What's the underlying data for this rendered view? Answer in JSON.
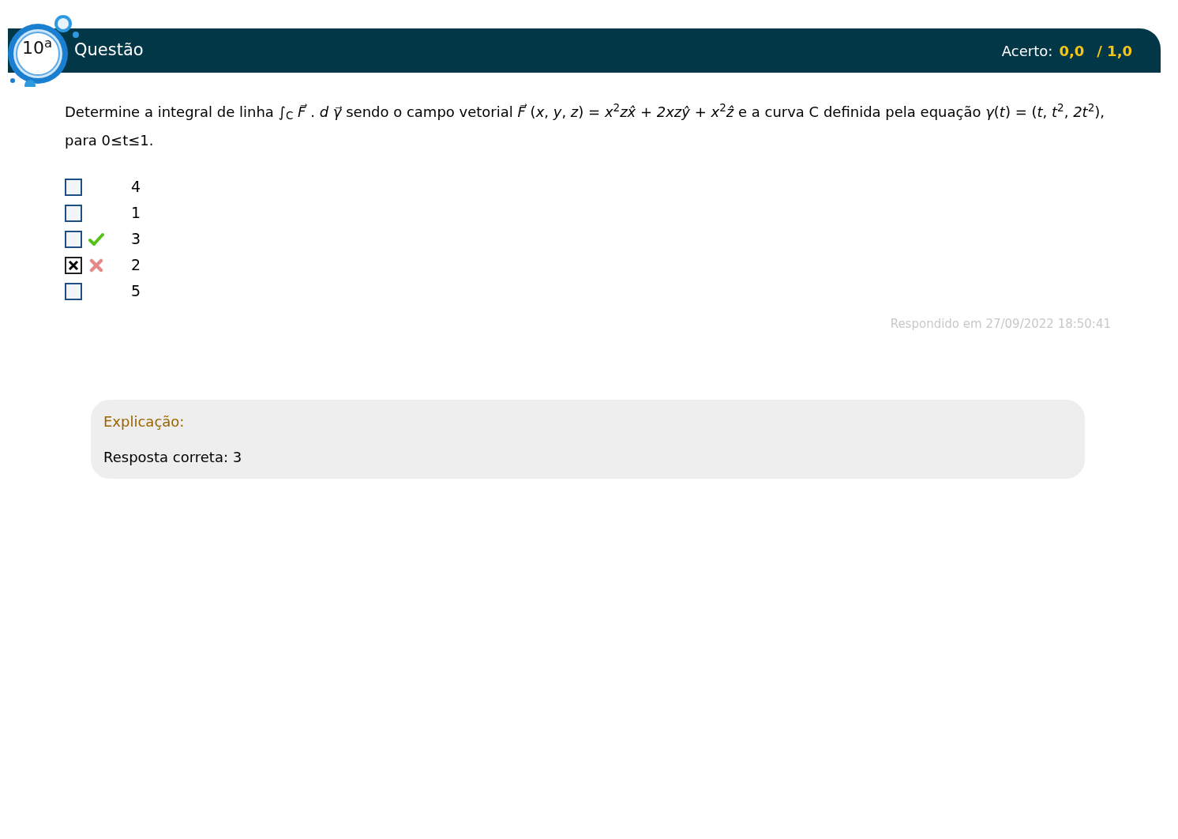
{
  "header": {
    "number": "10$^{a}$",
    "title": "Questão",
    "score_label": "Acerto:",
    "score": "0,0",
    "total": "/ 1,0"
  },
  "question": "Determine a integral de linha ∫$_{C}$ *F⃗* . *d* *γ⃗* sendo o campo vetorial *F⃗* (*x*, *y*, *z*) = *x*$^{2}$*zx̂* + *2xzŷ* + *x*$^{2}$*ẑ* e a curva C definida pela equação *γ*(*t*) = (*t*, *t*$^{2}$, *2t*$^{2}$), para 0≤t≤1.",
  "options": [
    {
      "text": "4",
      "checked": false,
      "kind": "plain"
    },
    {
      "text": "1",
      "checked": false,
      "kind": "plain"
    },
    {
      "text": "3",
      "checked": false,
      "kind": "correct"
    },
    {
      "text": "2",
      "checked": true,
      "kind": "wrong"
    },
    {
      "text": "5",
      "checked": false,
      "kind": "plain"
    }
  ],
  "answered": "Respondido em 27/09/2022 18:50:41",
  "explanation": {
    "title": "Explicação:",
    "text": "Resposta correta: 3"
  }
}
